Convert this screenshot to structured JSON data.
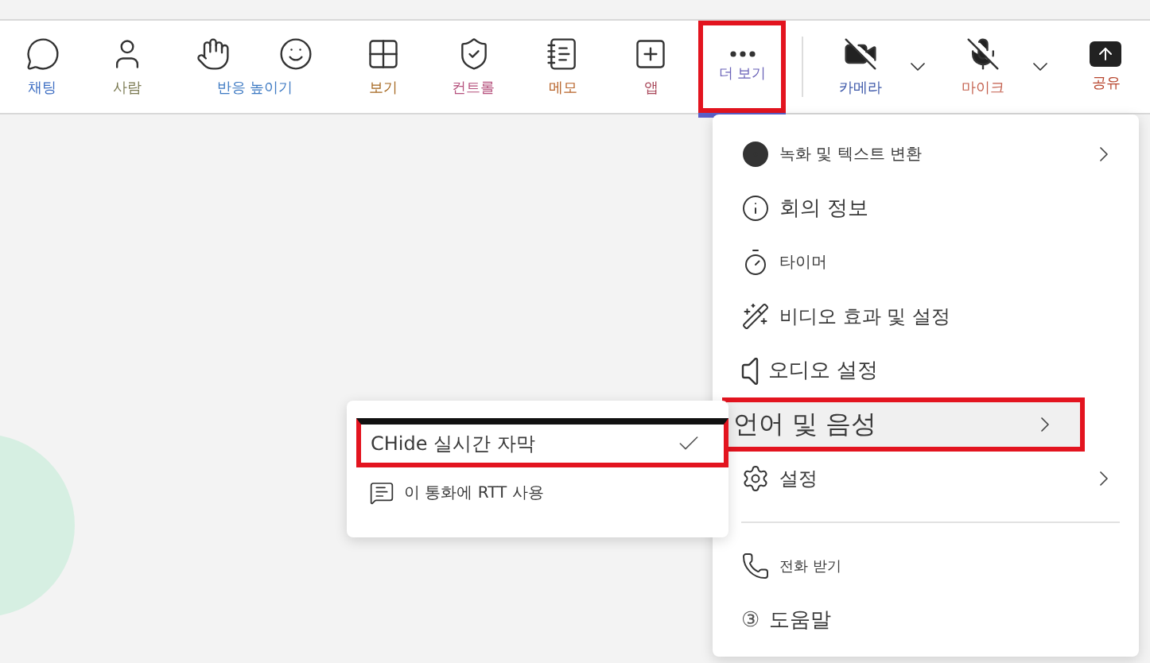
{
  "toolbar": {
    "items": [
      {
        "label": "채팅",
        "color": "#3b6cc2",
        "selected": false,
        "highlighted": false,
        "dropdown": false
      },
      {
        "label": "사람",
        "color": "#7b7a52",
        "selected": false,
        "highlighted": false,
        "dropdown": false
      },
      {
        "label": "반응 높이기",
        "color": "#3b78c2",
        "selected": false,
        "highlighted": false,
        "dropdown": false
      },
      {
        "label": "보기",
        "color": "#a5661e",
        "selected": false,
        "highlighted": false,
        "dropdown": false
      },
      {
        "label": "컨트롤",
        "color": "#b5507c",
        "selected": false,
        "highlighted": false,
        "dropdown": false
      },
      {
        "label": "메모",
        "color": "#b8642a",
        "selected": false,
        "highlighted": false,
        "dropdown": false
      },
      {
        "label": "앱",
        "color": "#a84558",
        "selected": false,
        "highlighted": false,
        "dropdown": false
      },
      {
        "label": "더 보기",
        "color": "#6a62b8",
        "selected": true,
        "highlighted": true,
        "dropdown": false
      },
      {
        "label": "카메라",
        "color": "#3a56a8",
        "selected": false,
        "highlighted": false,
        "dropdown": true
      },
      {
        "label": "마이크",
        "color": "#c4604e",
        "selected": false,
        "highlighted": false,
        "dropdown": true
      },
      {
        "label": "공유",
        "color": "#b8462e",
        "selected": false,
        "highlighted": false,
        "dropdown": false
      }
    ]
  },
  "menu": {
    "items": [
      {
        "label": "녹화 및 텍스트 변환",
        "submenu": true,
        "highlighted": false
      },
      {
        "label": "회의 정보",
        "submenu": false,
        "highlighted": false
      },
      {
        "label": "타이머",
        "submenu": false,
        "highlighted": false
      },
      {
        "label": "비디오 효과 및 설정",
        "submenu": false,
        "highlighted": false
      },
      {
        "label": "오디오 설정",
        "submenu": false,
        "highlighted": false
      },
      {
        "label": "언어 및 음성",
        "submenu": true,
        "highlighted": true
      },
      {
        "label": "설정",
        "submenu": true,
        "highlighted": false
      },
      {
        "label": "전화 받기",
        "submenu": false,
        "highlighted": false
      },
      {
        "label": "도움말",
        "icon_text": "③",
        "submenu": false,
        "highlighted": false
      }
    ]
  },
  "submenu": {
    "items": [
      {
        "label": "CHide 실시간 자막",
        "checked": true,
        "highlighted": true
      },
      {
        "label": "이 통화에 RTT 사용",
        "checked": false,
        "highlighted": false
      }
    ]
  }
}
